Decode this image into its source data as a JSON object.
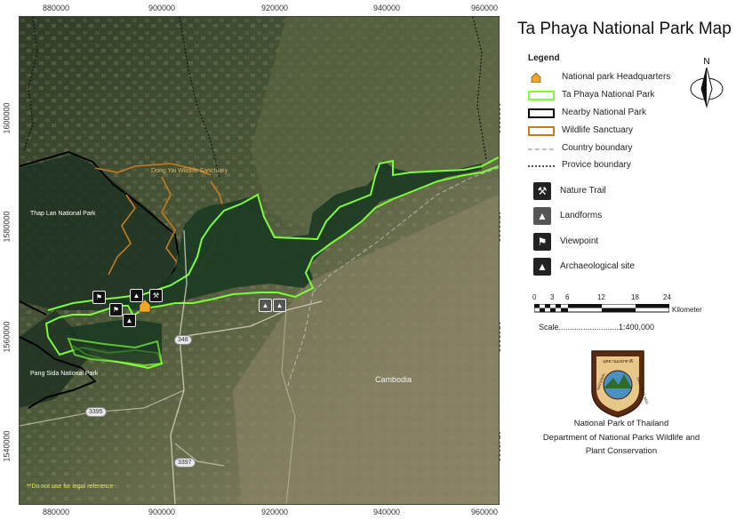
{
  "title": "Ta Phaya National Park Map",
  "axes": {
    "x_ticks": [
      "880000",
      "900000",
      "920000",
      "940000",
      "960000"
    ],
    "y_ticks": [
      "1600000",
      "1580000",
      "1560000",
      "1540000"
    ]
  },
  "map_labels": {
    "dong_yai": "Dong Yai Wildlife Sanctuary",
    "thap_lan": "Thap Lan National Park",
    "pang_sida": "Pang Sida National Park",
    "cambodia": "Cambodia",
    "road_348": "348",
    "road_3395": "3395",
    "road_3397": "3397",
    "disclaimer": "**Do not use for legal reference"
  },
  "legend": {
    "heading": "Legend",
    "headquarters": "National park Headquarters",
    "ta_phaya": "Ta Phaya National Park",
    "nearby_park": "Nearby National Park",
    "wildlife_sanctuary": "Wildlife Sanctuary",
    "country_boundary": "Country boundary",
    "province_boundary": "Provice boundary",
    "nature_trail": "Nature Trail",
    "landforms": "Landforms",
    "viewpoint": "Viewpoint",
    "archaeological": "Archaeological site",
    "colors": {
      "ta_phaya": "#7CFC3A",
      "nearby_park": "#000000",
      "wildlife_sanctuary": "#C77B1E",
      "headquarters": "#F5A623"
    },
    "icons": {
      "north_arrow": "north-arrow-icon",
      "nature_trail": "hiker-icon",
      "landforms": "rock-formation-icon",
      "viewpoint": "binocular-person-icon",
      "archaeological": "temple-ruin-icon"
    }
  },
  "north_label": "N",
  "scale": {
    "ticks": [
      "0",
      "3",
      "6",
      "12",
      "18",
      "24"
    ],
    "unit": "Kilometer",
    "text": "Scale...........................1:400,000"
  },
  "logo": {
    "top_text": "อุทยานแห่งชาติ",
    "left_text": "NATIONAL",
    "right_text": "PARK THAILAND"
  },
  "credits": {
    "line1": "National Park of Thailand",
    "line2": "Department of National Parks Wildlife and",
    "line3": "Plant Conservation"
  }
}
